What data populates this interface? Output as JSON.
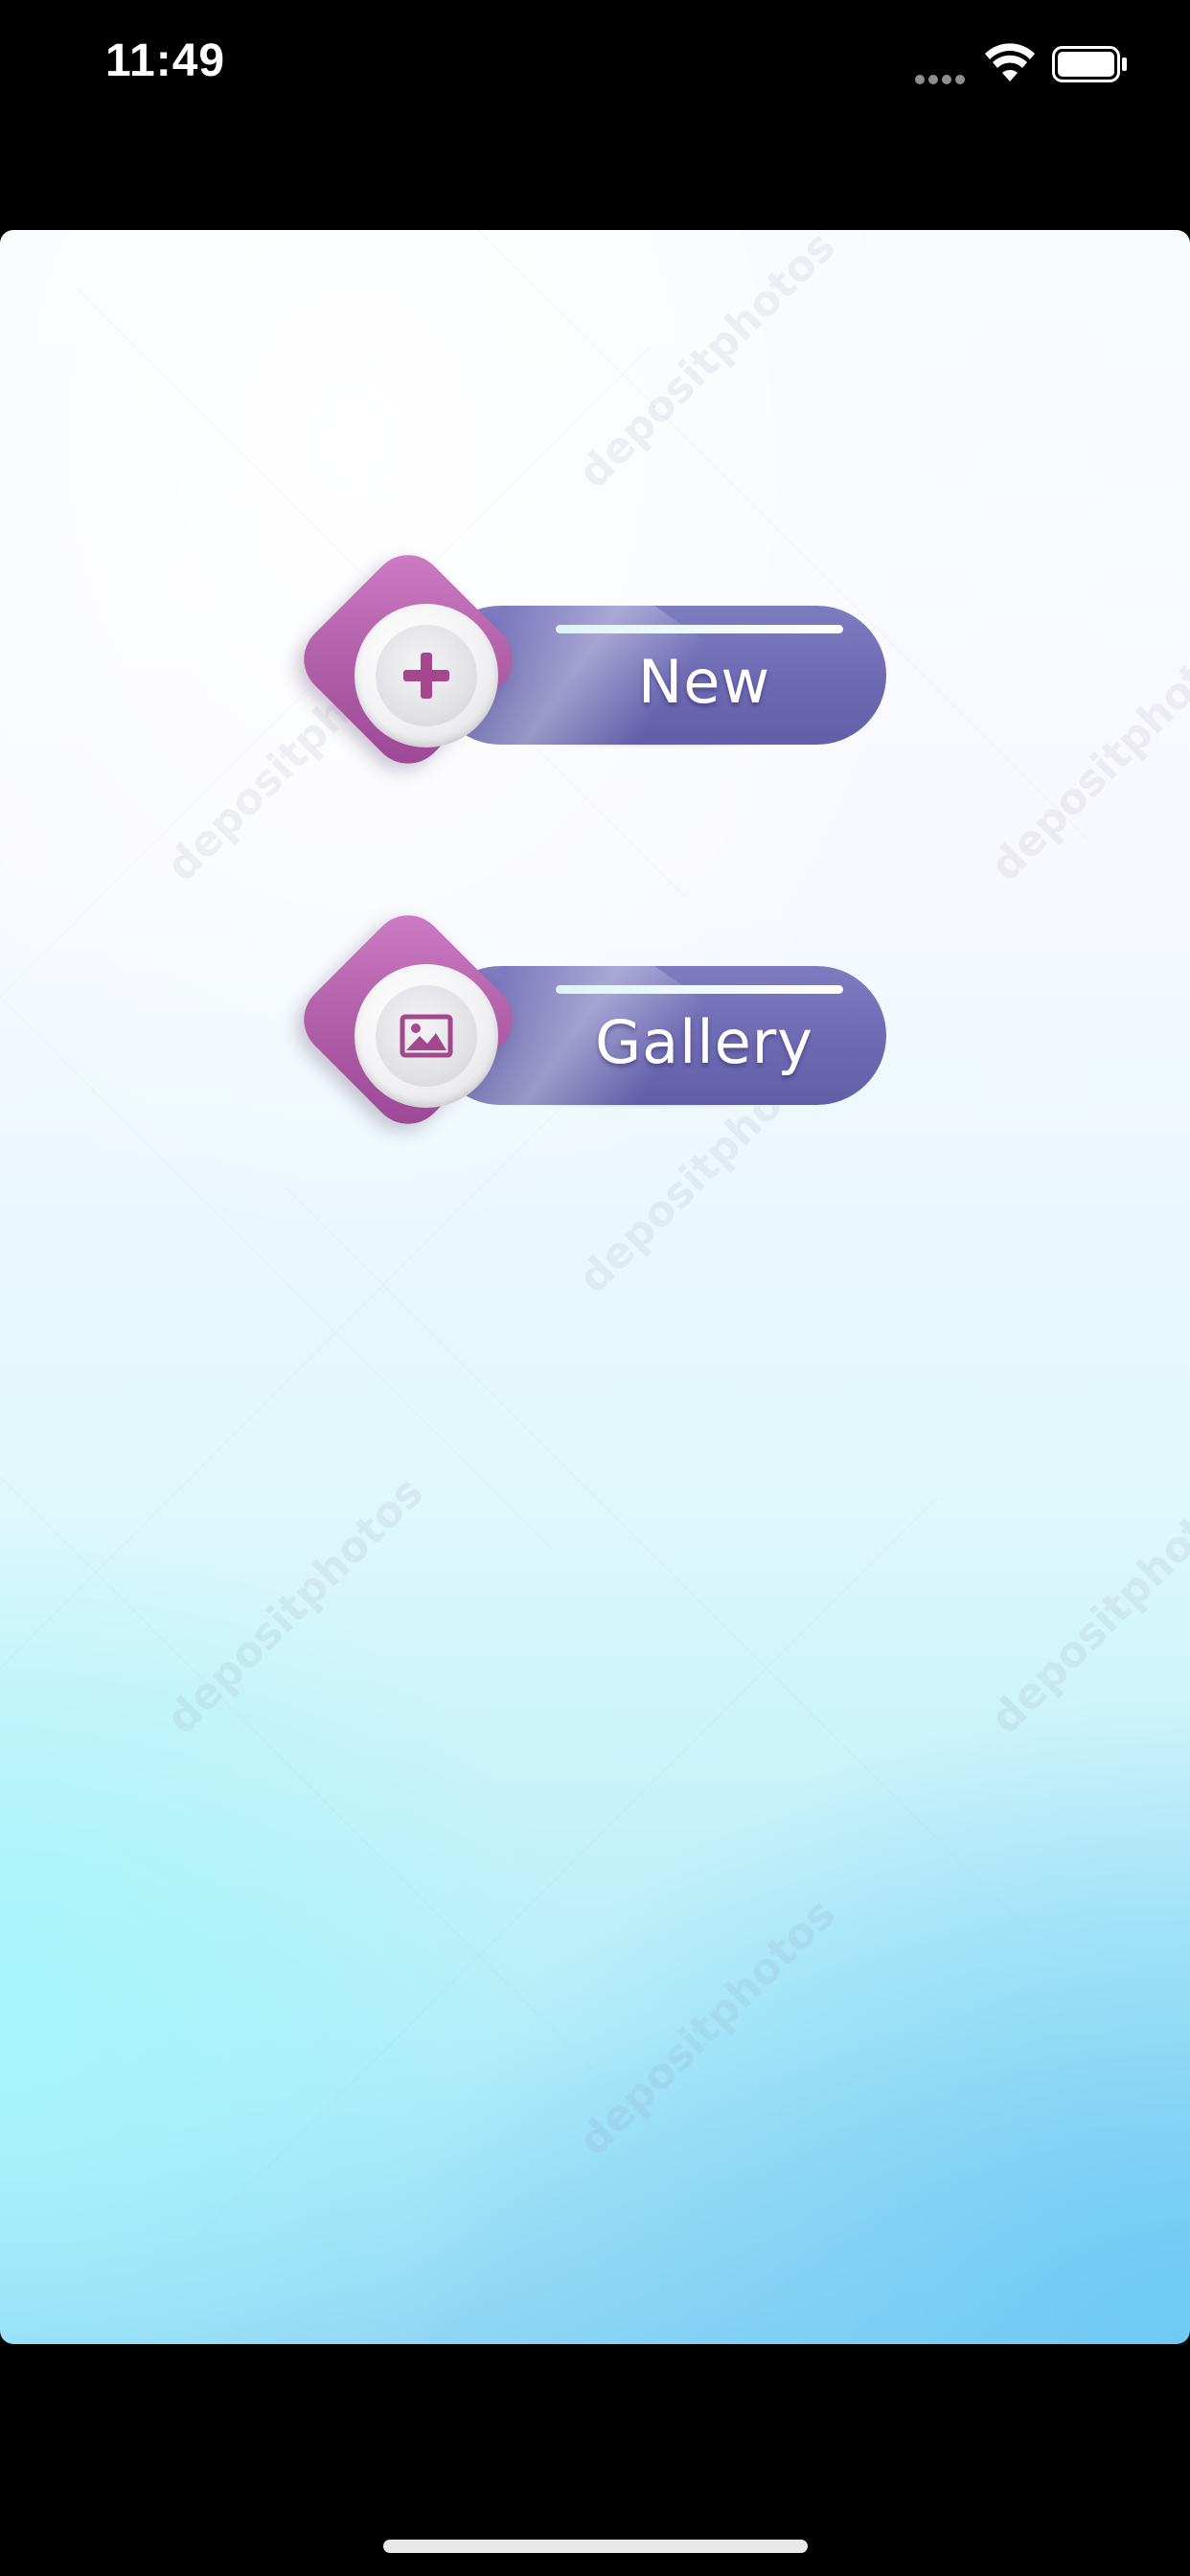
{
  "status_bar": {
    "time": "11:49",
    "signal_icon": "signal-dots-icon",
    "wifi_icon": "wifi-icon",
    "battery_icon": "battery-icon"
  },
  "menu": {
    "buttons": [
      {
        "label": "New",
        "icon": "plus-icon"
      },
      {
        "label": "Gallery",
        "icon": "image-icon"
      }
    ]
  },
  "background": {
    "watermark_text": "depositphotos"
  },
  "colors": {
    "pill": "#6d6ab3",
    "diamond": "#b463aa",
    "icon": "#a5478f",
    "background_top": "#f7fbfe",
    "background_bottom": "#8fd6f5"
  }
}
